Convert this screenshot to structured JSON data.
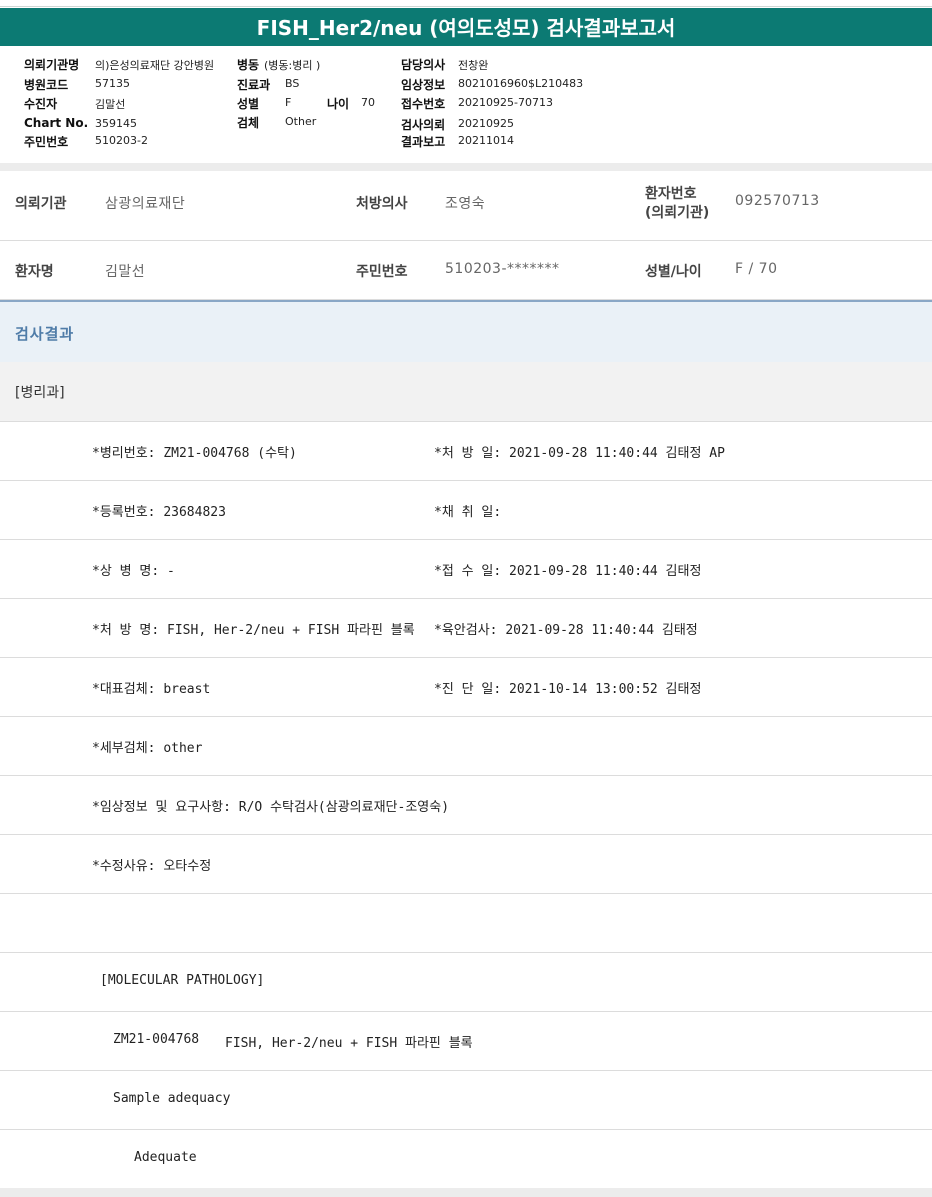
{
  "title": "FISH_Her2/neu (여의도성모) 검사결과보고서",
  "header": {
    "left": [
      {
        "label": "의뢰기관명",
        "value": "의)은성의료재단 강안병원"
      },
      {
        "label": "병원코드",
        "value": "57135"
      },
      {
        "label": "수진자",
        "value": "김말선"
      },
      {
        "label": "Chart No.",
        "value": "359145"
      },
      {
        "label": "주민번호",
        "value": "510203-2"
      }
    ],
    "ward": {
      "label": "병동",
      "value": "(병동:병리 )"
    },
    "dept": {
      "label": "진료과",
      "value": "BS"
    },
    "sex": {
      "label": "성별",
      "value": "F"
    },
    "age": {
      "label": "나이",
      "value": "70"
    },
    "specimen": {
      "label": "검체",
      "value": "Other"
    },
    "right": [
      {
        "label": "담당의사",
        "value": "전창완"
      },
      {
        "label": "임상정보",
        "value": "8021016960$L210483"
      },
      {
        "label": "접수번호",
        "value": "20210925-70713"
      },
      {
        "label": "검사의뢰",
        "value": "20210925"
      },
      {
        "label": "결과보고",
        "value": "20211014"
      }
    ]
  },
  "info": {
    "requesting_org_label": "의뢰기관",
    "requesting_org": "삼광의료재단",
    "doctor_label": "처방의사",
    "doctor": "조영숙",
    "patient_no_label_1": "환자번호",
    "patient_no_label_2": "(의뢰기관)",
    "patient_no": "092570713",
    "patient_name_label": "환자명",
    "patient_name": "김말선",
    "ssn_label": "주민번호",
    "ssn": "510203-*******",
    "sex_age_label": "성별/나이",
    "sex_age": "F / 70"
  },
  "result_title": "검사결과",
  "department": "[병리과]",
  "rows": [
    {
      "left": "*병리번호: ZM21-004768 (수탁)",
      "right": "*처 방 일: 2021-09-28 11:40:44  김태정 AP"
    },
    {
      "left": "*등록번호: 23684823",
      "right": "*채 취 일:"
    },
    {
      "left": "*상 병 명: -",
      "right": "*접 수 일: 2021-09-28 11:40:44  김태정"
    },
    {
      "left": "*처 방 명: FISH, Her-2/neu + FISH 파라핀 블록",
      "right": "*육안검사: 2021-09-28 11:40:44  김태정"
    },
    {
      "left": "*대표검체: breast",
      "right": "*진 단 일: 2021-10-14 13:00:52  김태정"
    },
    {
      "left": "*세부검체: other",
      "right": ""
    },
    {
      "left": "*임상정보 및 요구사항: R/O 수탁검사(삼광의료재단-조영숙)",
      "right": ""
    },
    {
      "left": "*수정사유: 오타수정",
      "right": ""
    }
  ],
  "molecular": {
    "heading": "[MOLECULAR PATHOLOGY]",
    "case_id": "ZM21-004768",
    "case_test": "FISH, Her-2/neu + FISH 파라핀 블록",
    "sample_label": "Sample adequacy",
    "sample_value": "Adequate"
  }
}
